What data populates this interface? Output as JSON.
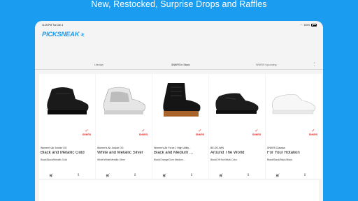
{
  "headline": "New, Restocked, Surprise Drops and Raffles",
  "statusbar": {
    "time": "11:06 PM  Tue Jan 3",
    "battery": "100%"
  },
  "app": {
    "logo": "PICKSNEAK"
  },
  "tabs": [
    {
      "label": "Lifestyle",
      "active": false
    },
    {
      "label": "SNKRS In Stock",
      "active": true
    },
    {
      "label": "SNKRS Upcoming",
      "active": false
    }
  ],
  "products": [
    {
      "subtitle": "Women's Air Jordan OG",
      "name": "Black and Metallic Gold",
      "colorway": "Black/Black/Metallic Gold",
      "badge": "SNKRS"
    },
    {
      "subtitle": "Women's Air Jordan OG",
      "name": "White and Metallic Silver",
      "colorway": "White/White/Metallic Silver",
      "badge": "SNKRS"
    },
    {
      "subtitle": "Women's Air Force 1 High Utility...",
      "name": "Black and Medium ...",
      "colorway": "Black/Orange/Gum Medium...",
      "badge": "SNKRS"
    },
    {
      "subtitle": "BE-DO-WIN",
      "name": "Around The World",
      "colorway": "Black/Off Noir/Multi-Color",
      "badge": "SNKRS"
    },
    {
      "subtitle": "SNKRS Classics",
      "name": "For Your Rotation",
      "colorway": "Black/Black/Black/Black",
      "badge": "SNKRS"
    }
  ],
  "colors": {
    "brand": "#1a9cf0",
    "snkrs": "#e8201a"
  }
}
